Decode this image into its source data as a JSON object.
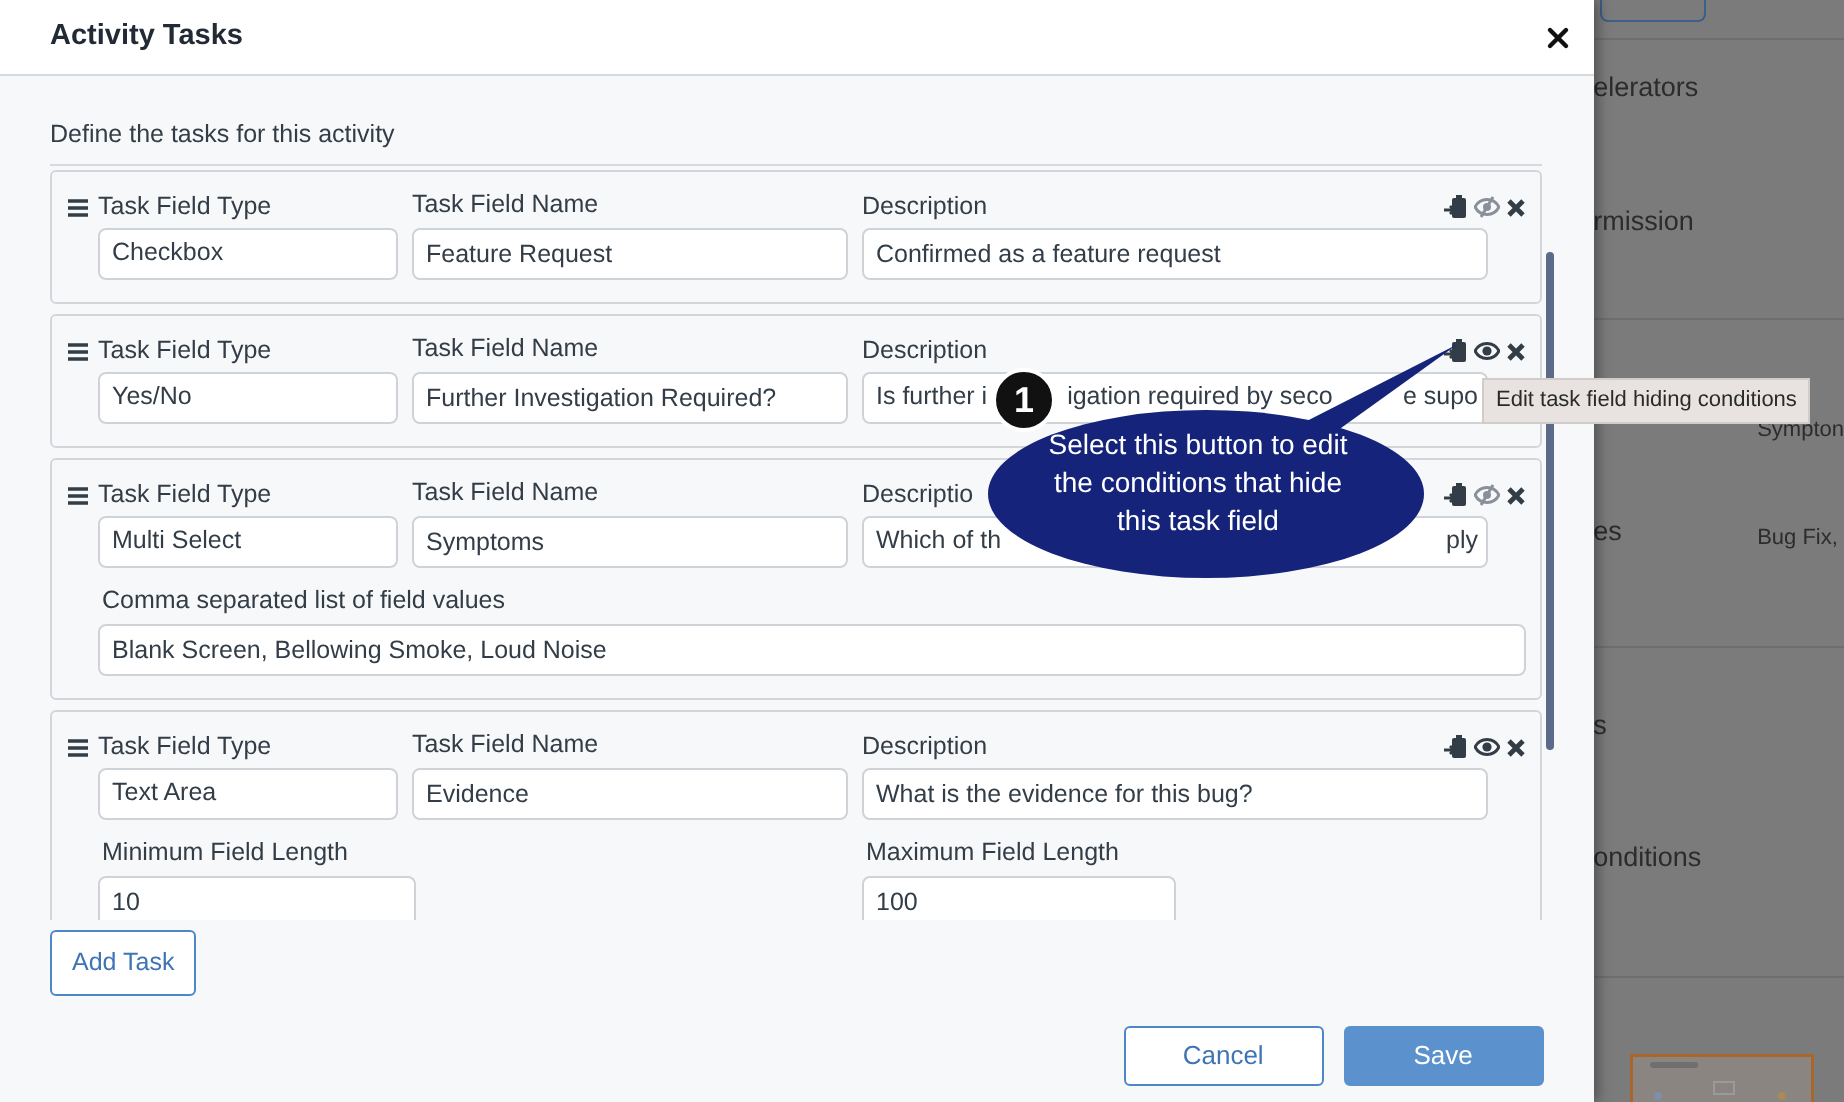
{
  "dialog": {
    "title": "Activity Tasks",
    "intro": "Define the tasks for this activity",
    "tasks": [
      {
        "kind": "checkbox",
        "type_label": "Task Field Type",
        "type_value": "Checkbox",
        "name_label": "Task Field Name",
        "name_value": "Feature Request",
        "description_label": "Description",
        "description_value": "Confirmed as a feature request",
        "has_hiding_conditions": false
      },
      {
        "kind": "yes_no",
        "type_label": "Task Field Type",
        "type_value": "Yes/No",
        "name_label": "Task Field Name",
        "name_value": "Further Investigation Required?",
        "description_label": "Description",
        "description_fragments": [
          "Is further i",
          "igation required by seco",
          "e supo"
        ],
        "has_hiding_conditions": true
      },
      {
        "kind": "multi_select",
        "type_label": "Task Field Type",
        "type_value": "Multi Select",
        "name_label": "Task Field Name",
        "name_value": "Symptoms",
        "description_label": "Descriptio",
        "description_fragments": [
          "Which of th",
          "ply"
        ],
        "has_hiding_conditions": false,
        "values_label": "Comma separated list of field values",
        "values_value": "Blank Screen, Bellowing Smoke, Loud Noise"
      },
      {
        "kind": "text_area",
        "type_label": "Task Field Type",
        "type_value": "Text Area",
        "name_label": "Task Field Name",
        "name_value": "Evidence",
        "description_label": "Description",
        "description_value": "What is the evidence for this bug?",
        "has_hiding_conditions": true,
        "min_label": "Minimum Field Length",
        "min_value": "10",
        "max_label": "Maximum Field Length",
        "max_value": "100"
      }
    ],
    "add_button": "Add Task",
    "buttons": [
      {
        "label": "Cancel",
        "kind": "secondary"
      },
      {
        "label": "Save",
        "kind": "primary"
      }
    ]
  },
  "callout": {
    "number": "1",
    "text": "Select this button to edit the conditions that hide this task field"
  },
  "tooltip": "Edit task field hiding conditions",
  "background_page": {
    "sections": [
      {
        "lines": [
          "elerators",
          "rmission"
        ]
      },
      {
        "label": "es",
        "values": [
          "Sympton",
          "Bug Fix,"
        ]
      },
      {
        "lines": [
          "s",
          "onditions"
        ]
      }
    ]
  }
}
